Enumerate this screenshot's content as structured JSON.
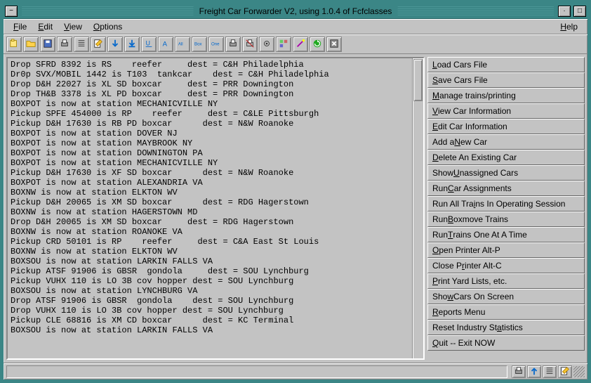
{
  "window": {
    "title": "Freight Car Forwarder V2, using 1.0.4 of Fcfclasses"
  },
  "menus": {
    "file": "File",
    "edit": "Edit",
    "view": "View",
    "options": "Options",
    "help": "Help"
  },
  "toolbar_icons": [
    "open-file",
    "open-folder",
    "save",
    "print",
    "list",
    "edit-note",
    "arrow-down",
    "arrow-down-bar",
    "underline",
    "letter-a",
    "all",
    "box",
    "one",
    "print-2",
    "print-3",
    "settings",
    "props",
    "wand",
    "refresh",
    "close"
  ],
  "log_lines": [
    "Drop SFRD 8392 is RS    reefer     dest = C&H Philadelphia",
    "Dr0p SVX/MOBIL 1442 is T103  tankcar    dest = C&H Philadelphia",
    "Drop D&H 22027 is XL SD boxcar     dest = PRR Downington",
    "Drop TH&B 3378 is XL PD boxcar     dest = PRR Downington",
    "BOXPOT is now at station MECHANICVILLE NY",
    "Pickup SPFE 454000 is RP    reefer     dest = C&LE Pittsburgh",
    "Pickup D&H 17630 is RB PD boxcar      dest = N&W Roanoke",
    "BOXPOT is now at station DOVER NJ",
    "BOXPOT is now at station MAYBROOK NY",
    "BOXPOT is now at station DOWNINGTON PA",
    "BOXPOT is now at station MECHANICVILLE NY",
    "Pickup D&H 17630 is XF SD boxcar      dest = N&W Roanoke",
    "BOXPOT is now at station ALEXANDRIA VA",
    "BOXNW is now at station ELKTON WV",
    "Pickup D&H 20065 is XM SD boxcar      dest = RDG Hagerstown",
    "BOXNW is now at station HAGERSTOWN MD",
    "Drop D&H 20065 is XM SD boxcar     dest = RDG Hagerstown",
    "BOXNW is now at station ROANOKE VA",
    "Pickup CRD 50101 is RP    reefer     dest = C&A East St Louis",
    "BOXNW is now at station ELKTON WV",
    "BOXSOU is now at station LARKIN FALLS VA",
    "Pickup ATSF 91906 is GBSR  gondola     dest = SOU Lynchburg",
    "Pickup VUHX 110 is LO 3B cov hopper dest = SOU Lynchburg",
    "BOXSOU is now at station LYNCHBURG VA",
    "Drop ATSF 91906 is GBSR  gondola    dest = SOU Lynchburg",
    "Drop VUHX 110 is LO 3B cov hopper dest = SOU Lynchburg",
    "Pickup CLE 68816 is XM CD boxcar      dest = KC Terminal",
    "BOXSOU is now at station LARKIN FALLS VA"
  ],
  "side_buttons": [
    {
      "pre": "",
      "u": "L",
      "post": "oad Cars File"
    },
    {
      "pre": "",
      "u": "S",
      "post": "ave Cars File"
    },
    {
      "pre": "",
      "u": "M",
      "post": "anage trains/printing"
    },
    {
      "pre": "",
      "u": "V",
      "post": "iew Car Information"
    },
    {
      "pre": "",
      "u": "E",
      "post": "dit Car Information"
    },
    {
      "pre": "Add a ",
      "u": "N",
      "post": "ew Car"
    },
    {
      "pre": "",
      "u": "D",
      "post": "elete An Existing Car"
    },
    {
      "pre": "Show ",
      "u": "U",
      "post": "nassigned Cars"
    },
    {
      "pre": "Run ",
      "u": "C",
      "post": "ar Assignments"
    },
    {
      "pre": "Run All Tra",
      "u": "i",
      "post": "ns In Operating Session"
    },
    {
      "pre": "Run ",
      "u": "B",
      "post": "oxmove Trains"
    },
    {
      "pre": "Run ",
      "u": "T",
      "post": "rains One At A Time"
    },
    {
      "pre": "",
      "u": "O",
      "post": "pen Printer  Alt-P"
    },
    {
      "pre": "Close P",
      "u": "r",
      "post": "inter  Alt-C"
    },
    {
      "pre": "",
      "u": "P",
      "post": "rint Yard Lists, etc."
    },
    {
      "pre": "Sho",
      "u": "w",
      "post": " Cars On Screen"
    },
    {
      "pre": "",
      "u": "R",
      "post": "eports Menu"
    },
    {
      "pre": "Reset Industry St",
      "u": "a",
      "post": "tistics"
    },
    {
      "pre": "",
      "u": "Q",
      "post": "uit -- Exit NOW"
    }
  ],
  "status_icons": [
    "print",
    "arrow-up",
    "list",
    "edit"
  ]
}
